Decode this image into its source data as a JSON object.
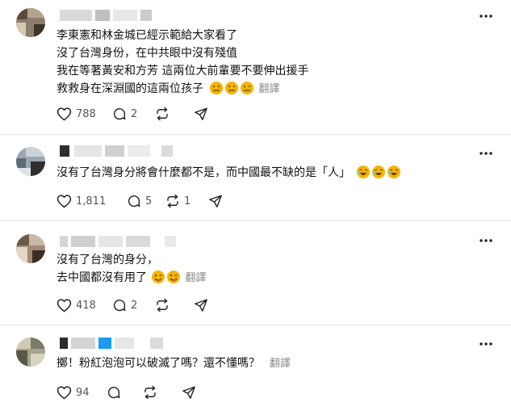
{
  "icons": {
    "like": "heart-icon",
    "reply": "comment-bubble-icon",
    "repost": "repost-icon",
    "share": "share-icon",
    "more": "more-horizontal-icon"
  },
  "translate_label": "翻譯",
  "posts": [
    {
      "lines": [
        "李東憲和林金城已經示範給大家看了",
        "沒了台灣身份，在中共眼中沒有殘值",
        "我在等著黃安和方芳 這兩位大前輩要不要伸出援手",
        "救救身在深淵國的這兩位孩子"
      ],
      "emoji": [
        "neutral",
        "neutral",
        "neutral"
      ],
      "likes": "788",
      "replies": "2",
      "reposts": "",
      "shares": ""
    },
    {
      "lines": [
        "沒有了台灣身分將會什麼都不是，而中國最不缺的是「人」"
      ],
      "emoji": [
        "laugh",
        "laugh",
        "laugh"
      ],
      "likes": "1,811",
      "replies": "5",
      "reposts": "1",
      "shares": ""
    },
    {
      "lines": [
        "沒有了台灣的身分，",
        "去中國都沒有用了"
      ],
      "emoji": [
        "wink",
        "wink"
      ],
      "likes": "418",
      "replies": "2",
      "reposts": "",
      "shares": ""
    },
    {
      "lines": [
        "擲！粉紅泡泡可以破滅了嗎？還不懂嗎？"
      ],
      "emoji": [],
      "likes": "94",
      "replies": "",
      "reposts": "",
      "shares": ""
    }
  ],
  "colors": {
    "divider": "#e5e5e5",
    "icon": "#222222",
    "muted": "#8a8a8a",
    "emoji": "#f4b400",
    "verified": "#1d9bf0"
  }
}
